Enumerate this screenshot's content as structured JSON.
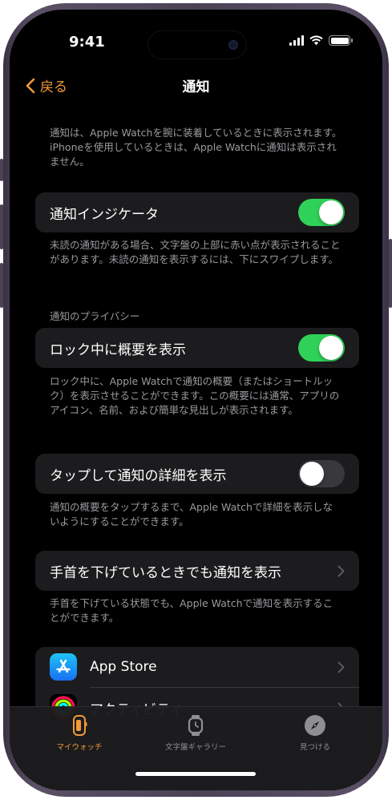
{
  "status_bar": {
    "time": "9:41"
  },
  "nav": {
    "back_label": "戻る",
    "title": "通知"
  },
  "intro_footnote": "通知は、Apple Watchを腕に装着しているときに表示されます。iPhoneを使用しているときは、Apple Watchに通知は表示されません。",
  "settings": {
    "indicator": {
      "label": "通知インジケータ",
      "enabled": true,
      "footnote": "未読の通知がある場合、文字盤の上部に赤い点が表示されることがあります。未読の通知を表示するには、下にスワイプします。"
    },
    "privacy_header": "通知のプライバシー",
    "summary_locked": {
      "label": "ロック中に概要を表示",
      "enabled": true,
      "footnote": "ロック中に、Apple Watchで通知の概要（またはショートルック）を表示させることができます。この概要には通常、アプリのアイコン、名前、および簡単な見出しが表示されます。"
    },
    "tap_details": {
      "label": "タップして通知の詳細を表示",
      "enabled": false,
      "footnote": "通知の概要をタップするまで、Apple Watchで詳細を表示しないようにすることができます。"
    },
    "wrist_down": {
      "label": "手首を下げているときでも通知を表示",
      "footnote": "手首を下げている状態でも、Apple Watchで通知を表示することができます。"
    }
  },
  "apps": [
    {
      "label": "App Store",
      "icon": "app-store-icon"
    },
    {
      "label": "アクティビティ",
      "icon": "activity-icon"
    }
  ],
  "tab_bar": {
    "tabs": [
      {
        "label": "マイウォッチ",
        "icon": "watch-icon",
        "active": true
      },
      {
        "label": "文字盤ギャラリー",
        "icon": "watch-face-icon",
        "active": false
      },
      {
        "label": "見つける",
        "icon": "compass-icon",
        "active": false
      }
    ]
  },
  "colors": {
    "accent": "#f19a37",
    "toggle_on": "#30d158",
    "toggle_off": "#39393d",
    "background": "#000000",
    "cell": "#1c1c1e",
    "secondary_text": "#9b9ba0"
  }
}
